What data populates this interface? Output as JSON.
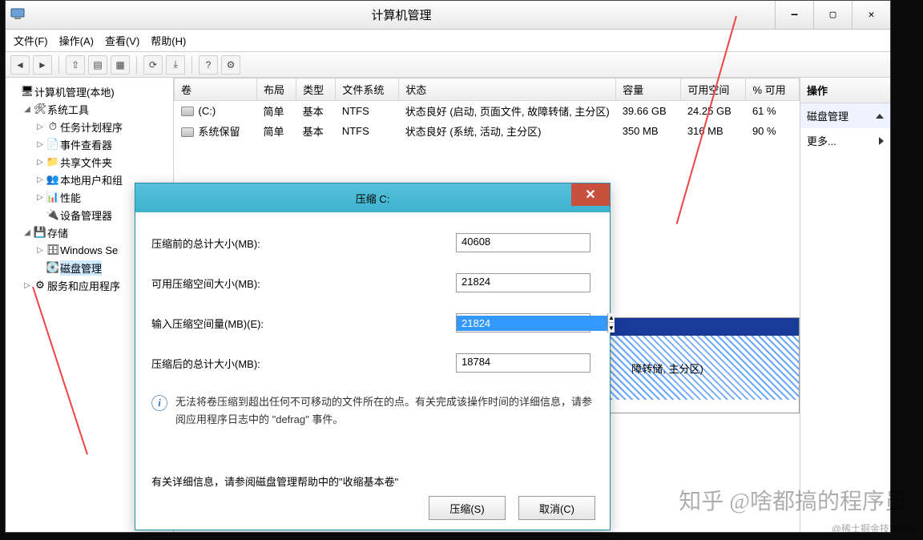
{
  "window": {
    "title": "计算机管理",
    "min": "—",
    "max": "▢",
    "close": "✕"
  },
  "menu": {
    "file": "文件(F)",
    "action": "操作(A)",
    "view": "查看(V)",
    "help": "帮助(H)"
  },
  "tree": {
    "root": "计算机管理(本地)",
    "system_tools": "系统工具",
    "task_scheduler": "任务计划程序",
    "event_viewer": "事件查看器",
    "shared_folders": "共享文件夹",
    "local_users": "本地用户和组",
    "performance": "性能",
    "device_manager": "设备管理器",
    "storage": "存储",
    "windows_server": "Windows Se",
    "disk_management": "磁盘管理",
    "services_apps": "服务和应用程序"
  },
  "columns": {
    "volume": "卷",
    "layout": "布局",
    "type": "类型",
    "fs": "文件系统",
    "status": "状态",
    "capacity": "容量",
    "free": "可用空间",
    "pct": "% 可用"
  },
  "rows": [
    {
      "volume": "(C:)",
      "layout": "简单",
      "type": "基本",
      "fs": "NTFS",
      "status": "状态良好 (启动, 页面文件, 故障转储, 主分区)",
      "capacity": "39.66 GB",
      "free": "24.25 GB",
      "pct": "61 %"
    },
    {
      "volume": "系统保留",
      "layout": "简单",
      "type": "基本",
      "fs": "NTFS",
      "status": "状态良好 (系统, 活动, 主分区)",
      "capacity": "350 MB",
      "free": "316 MB",
      "pct": "90 %"
    }
  ],
  "disk_tail": "障转储, 主分区)",
  "actions": {
    "header": "操作",
    "disk_mgmt": "磁盘管理",
    "more": "更多..."
  },
  "dialog": {
    "title": "压缩 C:",
    "before_label": "压缩前的总计大小(MB):",
    "before_value": "40608",
    "avail_label": "可用压缩空间大小(MB):",
    "avail_value": "21824",
    "input_label": "输入压缩空间量(MB)(E):",
    "input_value": "21824",
    "after_label": "压缩后的总计大小(MB):",
    "after_value": "18784",
    "info": "无法将卷压缩到超出任何不可移动的文件所在的点。有关完成该操作时间的详细信息，请参阅应用程序日志中的 \"defrag\" 事件。",
    "note": "有关详细信息，请参阅磁盘管理帮助中的\"收缩基本卷\"",
    "shrink": "压缩(S)",
    "cancel": "取消(C)"
  },
  "watermark": "知乎 @啥都搞的程序员",
  "watermark2": "@稀土掘金技术社区"
}
